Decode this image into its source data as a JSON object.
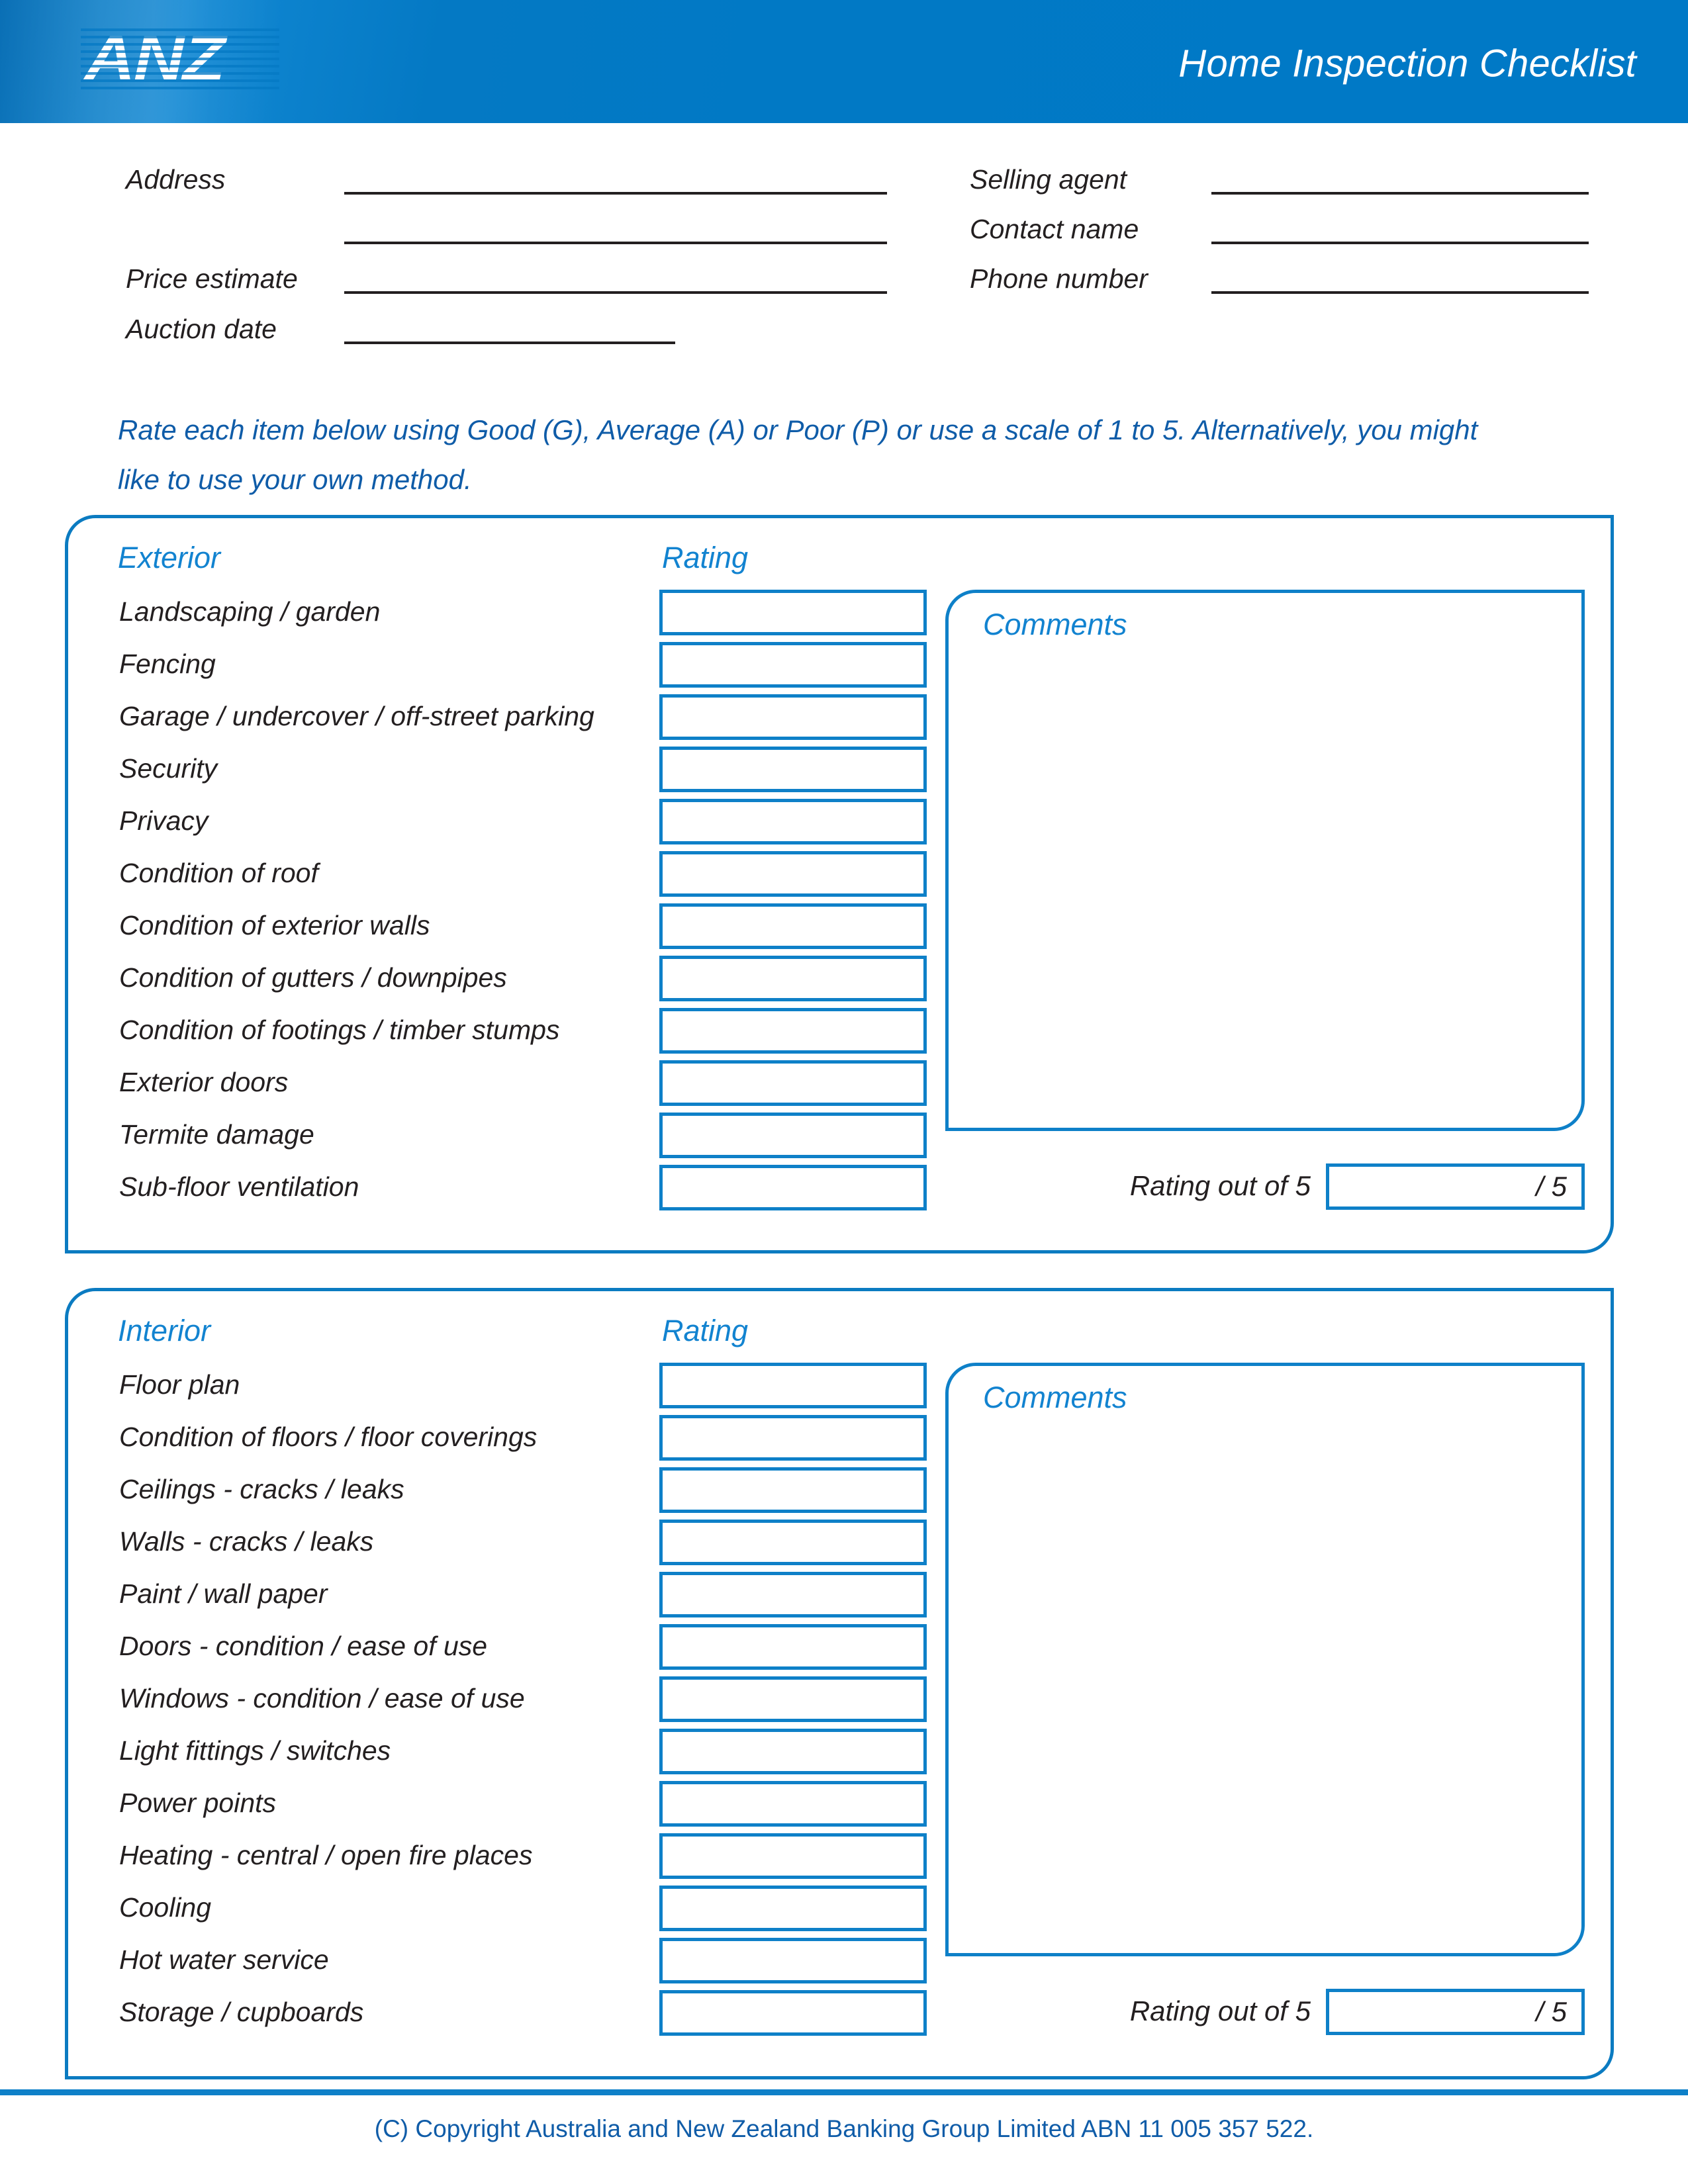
{
  "header": {
    "logo_text": "ANZ",
    "logo_icon": "anz-logo",
    "title": "Home Inspection Checklist",
    "banner_color": "#0479C4"
  },
  "form": {
    "left_fields": [
      {
        "label": "Address",
        "value": ""
      },
      {
        "label": "",
        "value": ""
      },
      {
        "label": "Price estimate",
        "value": ""
      },
      {
        "label": "Auction date",
        "value": ""
      }
    ],
    "right_fields": [
      {
        "label": "Selling agent",
        "value": ""
      },
      {
        "label": "Contact name",
        "value": ""
      },
      {
        "label": "Phone number",
        "value": ""
      }
    ]
  },
  "instructions": {
    "line1": "Rate each item below using Good (G), Average (A) or Poor (P) or use a scale of 1 to 5.  Alternatively, you might",
    "line2": "like to use your own method.",
    "color": "#0F5CA8"
  },
  "sections": [
    {
      "heading": "Exterior",
      "rating_heading": "Rating",
      "comments_label": "Comments",
      "comments_value": "",
      "rating_total_label": "Rating out of 5",
      "rating_total_suffix": "/ 5",
      "rating_total_value": "",
      "items": [
        {
          "label": "Landscaping / garden",
          "rating": ""
        },
        {
          "label": "Fencing",
          "rating": ""
        },
        {
          "label": "Garage / undercover / off-street parking",
          "rating": ""
        },
        {
          "label": "Security",
          "rating": ""
        },
        {
          "label": "Privacy",
          "rating": ""
        },
        {
          "label": "Condition of roof",
          "rating": ""
        },
        {
          "label": "Condition of exterior walls",
          "rating": ""
        },
        {
          "label": "Condition of gutters / downpipes",
          "rating": ""
        },
        {
          "label": "Condition of footings / timber stumps",
          "rating": ""
        },
        {
          "label": "Exterior doors",
          "rating": ""
        },
        {
          "label": "Termite damage",
          "rating": ""
        },
        {
          "label": "Sub-floor ventilation",
          "rating": ""
        }
      ]
    },
    {
      "heading": "Interior",
      "rating_heading": "Rating",
      "comments_label": "Comments",
      "comments_value": "",
      "rating_total_label": "Rating out of 5",
      "rating_total_suffix": "/ 5",
      "rating_total_value": "",
      "items": [
        {
          "label": "Floor plan",
          "rating": ""
        },
        {
          "label": "Condition of floors / floor coverings",
          "rating": ""
        },
        {
          "label": "Ceilings - cracks / leaks",
          "rating": ""
        },
        {
          "label": "Walls - cracks / leaks",
          "rating": ""
        },
        {
          "label": "Paint / wall paper",
          "rating": ""
        },
        {
          "label": "Doors - condition / ease of use",
          "rating": ""
        },
        {
          "label": "Windows - condition / ease of use",
          "rating": ""
        },
        {
          "label": "Light fittings / switches",
          "rating": ""
        },
        {
          "label": "Power points",
          "rating": ""
        },
        {
          "label": "Heating - central / open fire places",
          "rating": ""
        },
        {
          "label": "Cooling",
          "rating": ""
        },
        {
          "label": "Hot water service",
          "rating": ""
        },
        {
          "label": "Storage / cupboards",
          "rating": ""
        }
      ]
    }
  ],
  "footer": {
    "copyright": "(C) Copyright Australia and New Zealand Banking Group Limited ABN 11 005 357 522.",
    "color": "#0F5CA8"
  }
}
